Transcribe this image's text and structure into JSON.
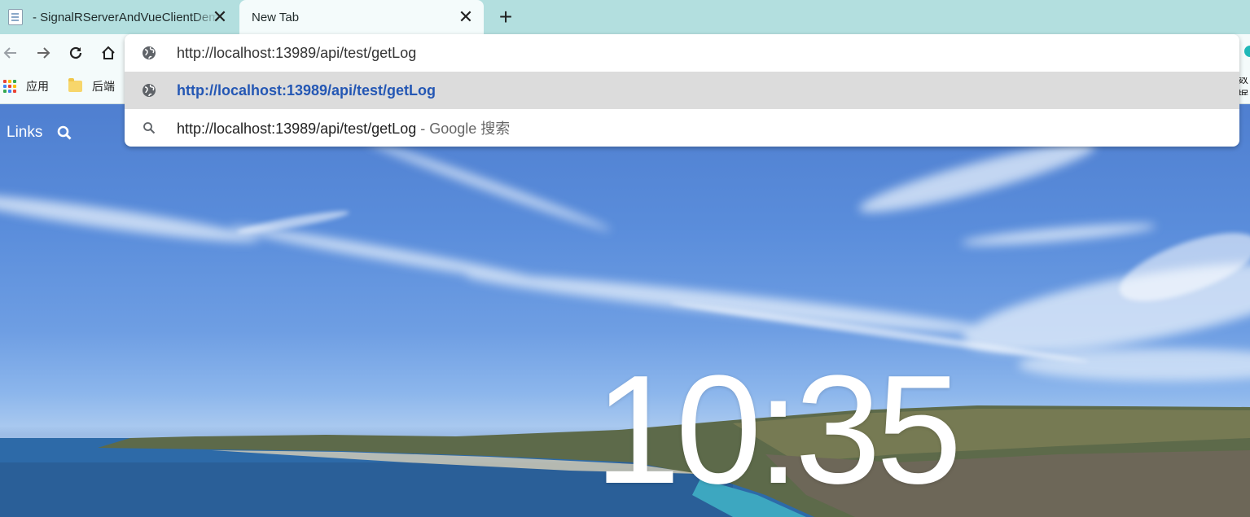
{
  "tabs": [
    {
      "title": "- SignalRServerAndVueClientDemo",
      "close_glyph": "✕",
      "favicon": "page-icon"
    },
    {
      "title": "New Tab",
      "close_glyph": "✕"
    }
  ],
  "new_tab_glyph": "+",
  "toolbar": {
    "back_icon": "arrow-left-icon",
    "forward_icon": "arrow-right-icon",
    "reload_icon": "reload-icon",
    "home_icon": "home-icon"
  },
  "bookmarks": {
    "apps_label": "应用",
    "folder_label": "后端",
    "right_partial": "数据"
  },
  "omnibox": {
    "input_value": "http://localhost:13989/api/test/getLog",
    "suggestions": [
      {
        "icon": "globe-icon",
        "url": "http://localhost:13989/api/test/getLog",
        "desc": ""
      },
      {
        "icon": "search-icon",
        "url": "http://localhost:13989/api/test/getLog",
        "desc": " - Google 搜索"
      }
    ]
  },
  "page": {
    "links_label": "Links",
    "clock": "10:35"
  },
  "colors": {
    "tabstrip": "#b3dfdf",
    "toolbar": "#f4fbfb",
    "accent": "#2457b4",
    "profile": "#1fb8b8"
  }
}
